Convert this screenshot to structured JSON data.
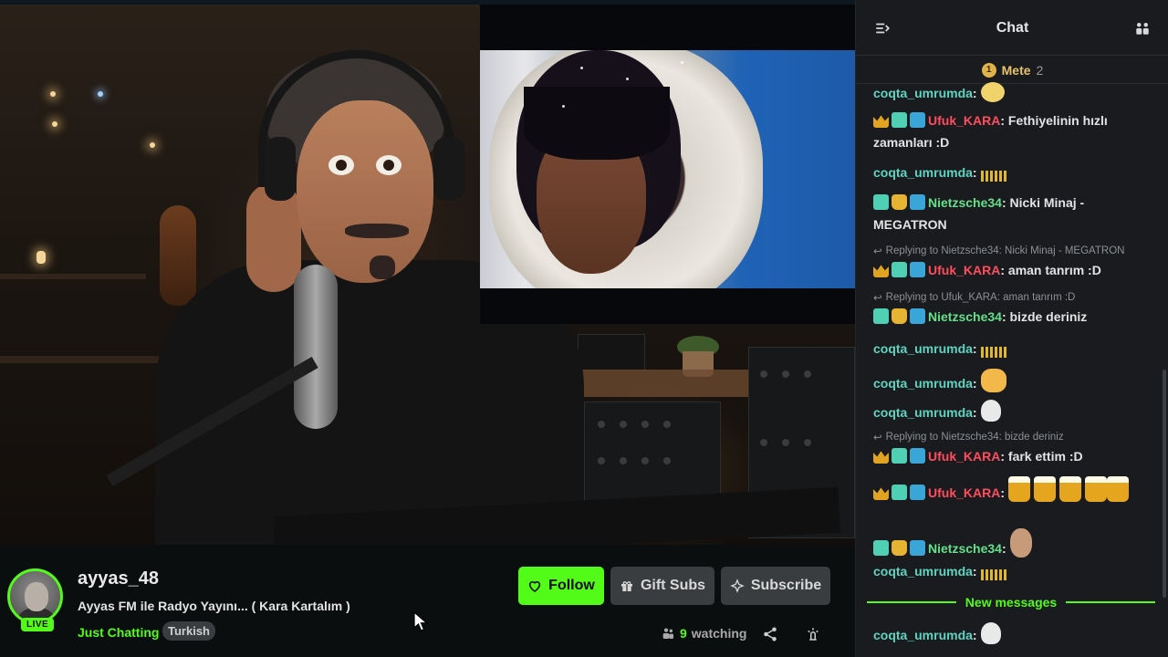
{
  "stream": {
    "channel_name": "ayyas_48",
    "title": "Ayyas FM ile Radyo Yayını... ( Kara Kartalım )",
    "category": "Just Chatting",
    "language_tag": "Turkish",
    "live_badge": "LIVE",
    "viewer_count": "9",
    "viewer_suffix": "watching"
  },
  "actions": {
    "follow_label": "Follow",
    "gift_label": "Gift Subs",
    "subscribe_label": "Subscribe"
  },
  "chat": {
    "title": "Chat",
    "pinned_user": "Mete",
    "pinned_count": "2",
    "new_messages_label": "New messages",
    "messages": [
      {
        "user": "coqta_umrumda",
        "text": ""
      },
      {
        "user": "Ufuk_KARA",
        "text": "Fethiyelinin hızlı zamanları :D"
      },
      {
        "user": "coqta_umrumda",
        "text": ""
      },
      {
        "user": "Nietzsche34",
        "text": "Nicki Minaj - MEGATRON"
      },
      {
        "reply": "Replying to Nietzsche34: Nicki Minaj - MEGATRON",
        "user": "Ufuk_KARA",
        "text": "aman tanrım :D"
      },
      {
        "reply": "Replying to Ufuk_KARA: aman tanrım :D",
        "user": "Nietzsche34",
        "text": "bizde deriniz"
      },
      {
        "user": "coqta_umrumda",
        "text": ""
      },
      {
        "user": "coqta_umrumda",
        "text": ""
      },
      {
        "user": "coqta_umrumda",
        "text": ""
      },
      {
        "reply": "Replying to Nietzsche34: bizde deriniz",
        "user": "Ufuk_KARA",
        "text": "fark ettim :D"
      },
      {
        "user": "Ufuk_KARA",
        "text": ""
      },
      {
        "user": "Nietzsche34",
        "text": ""
      },
      {
        "user": "coqta_umrumda",
        "text": ""
      },
      {
        "user": "coqta_umrumda",
        "text": ""
      }
    ]
  },
  "colors": {
    "accent": "#53fc18",
    "chat_bg": "#191b1f",
    "button_gray": "#3a3d40",
    "user_red": "#ff4d5e",
    "user_teal": "#5fd4c0",
    "user_green": "#64e08a"
  }
}
